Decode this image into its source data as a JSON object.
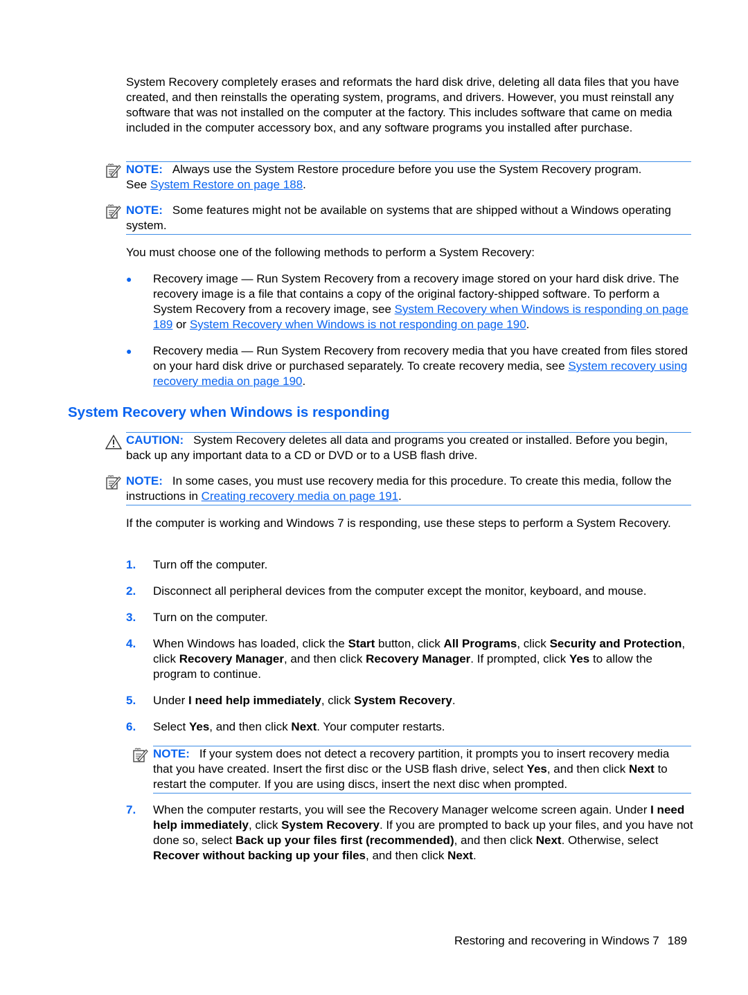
{
  "intro": "System Recovery completely erases and reformats the hard disk drive, deleting all data files that you have created, and then reinstalls the operating system, programs, and drivers. However, you must reinstall any software that was not installed on the computer at the factory. This includes software that came on media included in the computer accessory box, and any software programs you installed after purchase.",
  "note1": {
    "label": "NOTE:",
    "text": "Always use the System Restore procedure before you use the System Recovery program.",
    "pre_link": "See ",
    "link": "System Restore on page 188",
    "post_link": "."
  },
  "note2": {
    "label": "NOTE:",
    "text": "Some features might not be available on systems that are shipped without a Windows operating system."
  },
  "methods_intro": "You must choose one of the following methods to perform a System Recovery:",
  "bullets": [
    {
      "text": "Recovery image — Run System Recovery from a recovery image stored on your hard disk drive. The recovery image is a file that contains a copy of the original factory-shipped software. To perform a System Recovery from a recovery image, see ",
      "link1": "System Recovery when Windows is responding on page 189",
      "mid": " or ",
      "link2": "System Recovery when Windows is not responding on page 190",
      "end": "."
    },
    {
      "text": "Recovery media — Run System Recovery from recovery media that you have created from files stored on your hard disk drive or purchased separately. To create recovery media, see ",
      "link1": "System recovery using recovery media on page 190",
      "end": "."
    }
  ],
  "heading": "System Recovery when Windows is responding",
  "caution": {
    "label": "CAUTION:",
    "text": "System Recovery deletes all data and programs you created or installed. Before you begin, back up any important data to a CD or DVD or to a USB flash drive."
  },
  "note3": {
    "label": "NOTE:",
    "text": "In some cases, you must use recovery media for this procedure. To create this media, follow the instructions in ",
    "link": "Creating recovery media on page 191",
    "post_link": "."
  },
  "steps_intro": "If the computer is working and Windows 7 is responding, use these steps to perform a System Recovery.",
  "steps": [
    {
      "num": "1.",
      "text": "Turn off the computer."
    },
    {
      "num": "2.",
      "text": "Disconnect all peripheral devices from the computer except the monitor, keyboard, and mouse."
    },
    {
      "num": "3.",
      "text": "Turn on the computer."
    },
    {
      "num": "4.",
      "parts": [
        "When Windows has loaded, click the ",
        "Start",
        " button, click ",
        "All Programs",
        ", click ",
        "Security and Protection",
        ", click ",
        "Recovery Manager",
        ", and then click ",
        "Recovery Manager",
        ". If prompted, click ",
        "Yes",
        " to allow the program to continue."
      ]
    },
    {
      "num": "5.",
      "parts": [
        "Under ",
        "I need help immediately",
        ", click ",
        "System Recovery",
        "."
      ]
    },
    {
      "num": "6.",
      "parts": [
        "Select ",
        "Yes",
        ", and then click ",
        "Next",
        ". Your computer restarts."
      ]
    },
    {
      "num": "7.",
      "parts": [
        "When the computer restarts, you will see the Recovery Manager welcome screen again. Under ",
        "I need help immediately",
        ", click ",
        "System Recovery",
        ". If you are prompted to back up your files, and you have not done so, select ",
        "Back up your files first (recommended)",
        ", and then click ",
        "Next",
        ". Otherwise, select ",
        "Recover without backing up your files",
        ", and then click ",
        "Next",
        "."
      ]
    }
  ],
  "note4": {
    "label": "NOTE:",
    "parts": [
      "If your system does not detect a recovery partition, it prompts you to insert recovery media that you have created. Insert the first disc or the USB flash drive, select ",
      "Yes",
      ", and then click ",
      "Next",
      " to restart the computer. If you are using discs, insert the next disc when prompted."
    ]
  },
  "footer": {
    "title": "Restoring and recovering in Windows 7",
    "page": "189"
  }
}
